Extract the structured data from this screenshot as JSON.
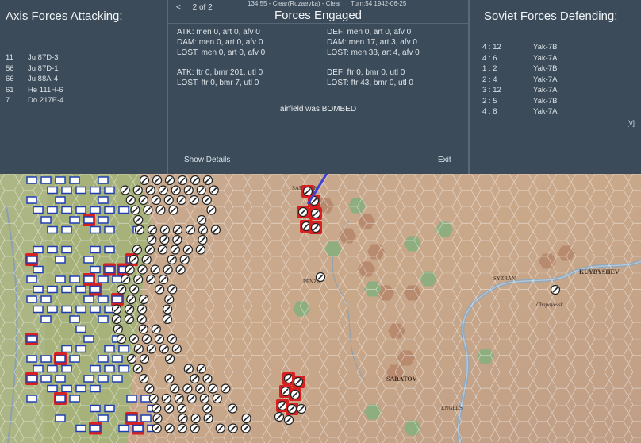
{
  "status_bar": {
    "hex": "134,55 - Clear(Ruzaevka) - Clear",
    "turn": "Turn:54  1942-06-25"
  },
  "left_panel": {
    "title": "Axis Forces Attacking:",
    "units": [
      {
        "count": "11",
        "type": "Ju 87D-3"
      },
      {
        "count": "56",
        "type": "Ju 87D-1"
      },
      {
        "count": "66",
        "type": "Ju 88A-4"
      },
      {
        "count": "61",
        "type": "He 111H-6"
      },
      {
        "count": "7",
        "type": "Do 217E-4"
      }
    ]
  },
  "center_panel": {
    "pager_prev": "<",
    "page": "2 of 2",
    "title": "Forces Engaged",
    "atk": [
      "ATK: men 0, art 0, afv 0",
      "DAM: men 0, art 0, afv 0",
      "LOST: men 0, art 0, afv 0"
    ],
    "def": [
      "DEF: men 0, art 0, afv 0",
      "DAM: men 17, art 3, afv 0",
      "LOST: men 38, art 4, afv 0"
    ],
    "atk_air": [
      "ATK: ftr 0, bmr 201, utl 0",
      "LOST: ftr 0, bmr 7, utl 0"
    ],
    "def_air": [
      "DEF: ftr 0, bmr 0, utl 0",
      "LOST: ftr 43, bmr 0, utl 0"
    ],
    "result": "airfield was BOMBED",
    "show_details": "Show Details",
    "exit": "Exit"
  },
  "right_panel": {
    "title": "Soviet Forces Defending:",
    "units": [
      {
        "count": "4 : 12",
        "type": "Yak-7B"
      },
      {
        "count": "4 : 6",
        "type": "Yak-7A"
      },
      {
        "count": "1 : 2",
        "type": "Yak-7B"
      },
      {
        "count": "2 : 4",
        "type": "Yak-7A"
      },
      {
        "count": "3 : 12",
        "type": "Yak-7A"
      },
      {
        "count": "2 : 5",
        "type": "Yak-7B"
      },
      {
        "count": "4 : 8",
        "type": "Yak-7A"
      }
    ],
    "toggle": "[v]"
  },
  "map": {
    "towns": [
      "SARANSK",
      "PENZA",
      "SYZRAN",
      "KUYBYSHEV",
      "Chapayevsk",
      "SARATOV",
      "ENGELS"
    ],
    "colors": {
      "terrain": "#c9a98c",
      "steppe_green": "#a2b274",
      "axis_unit": "#1f3fb0",
      "soviet_unit": "#222222",
      "engaged_border": "#d82020",
      "bomb_line": "#3d3fd9"
    }
  }
}
